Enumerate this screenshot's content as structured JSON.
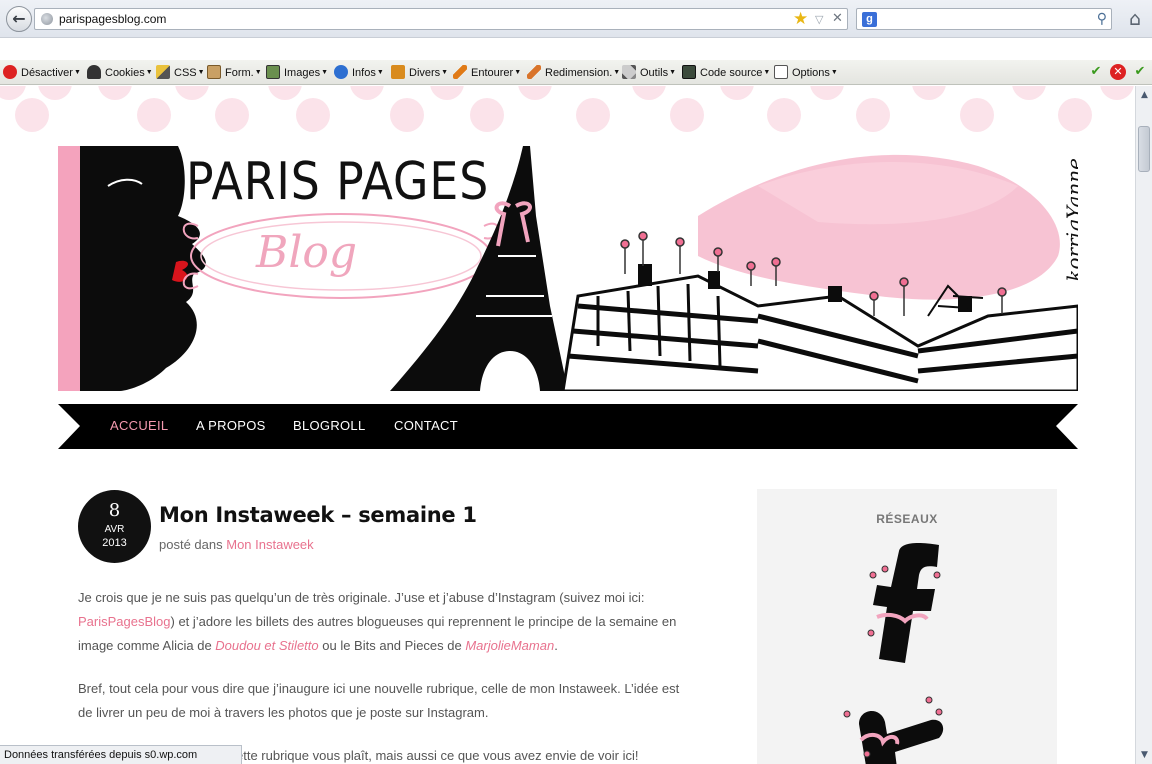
{
  "browser": {
    "url": "parispagesblog.com",
    "search_placeholder": ""
  },
  "toolbar": {
    "items": [
      {
        "label": "Désactiver",
        "icon": "block-icon"
      },
      {
        "label": "Cookies",
        "icon": "person-icon"
      },
      {
        "label": "CSS",
        "icon": "pen-icon"
      },
      {
        "label": "Form.",
        "icon": "clipboard-icon"
      },
      {
        "label": "Images",
        "icon": "image-icon"
      },
      {
        "label": "Infos",
        "icon": "info-icon"
      },
      {
        "label": "Divers",
        "icon": "book-icon"
      },
      {
        "label": "Entourer",
        "icon": "pencil-icon"
      },
      {
        "label": "Redimension.",
        "icon": "ruler-icon"
      },
      {
        "label": "Outils",
        "icon": "tools-icon"
      },
      {
        "label": "Code source",
        "icon": "terminal-icon"
      },
      {
        "label": "Options",
        "icon": "options-icon"
      }
    ]
  },
  "site": {
    "title": "PARIS PAGES",
    "subtitle": "Blog",
    "signature": "korrigYanne"
  },
  "menu": {
    "items": [
      "ACCUEIL",
      "A PROPOS",
      "BLOGROLL",
      "CONTACT"
    ],
    "active": "ACCUEIL"
  },
  "post": {
    "day": "8",
    "month": "AVR",
    "year": "2013",
    "title": "Mon Instaweek – semaine 1",
    "meta_prefix": "posté dans",
    "category": "Mon Instaweek",
    "p1": {
      "l1": "Je crois que je ne suis pas quelqu’un de très originale. J’use et j’abuse d’Instagram (suivez moi ici:",
      "link1": "ParisPagesBlog",
      "l2": ") et j’adore les billets des autres blogueuses qui reprennent le principe de la semaine en",
      "l3a": "image comme Alicia de ",
      "link2": "Doudou et Stiletto",
      "l3b": " ou le Bits and Pieces de ",
      "link3": "MarjolieMaman",
      "l3c": "."
    },
    "p2": {
      "l1": "Bref, tout cela pour vous dire que j’inaugure ici une nouvelle rubrique, celle de mon Instaweek. L’idée est",
      "l2": "de livrer un peu de moi à travers les photos que je poste sur Instagram."
    },
    "p3": {
      "l1": "ette rubrique vous plaît, mais aussi ce que vous avez envie de voir ici!"
    }
  },
  "sidebar": {
    "heading": "RÉSEAUX",
    "facebook_letter": "f",
    "twitter_letter": "t"
  },
  "status": {
    "text": "Données transférées depuis s0.wp.com"
  },
  "colors": {
    "accent_pink": "#e8728e",
    "menu_active": "#f49ab0",
    "ribbon": "#000000"
  }
}
